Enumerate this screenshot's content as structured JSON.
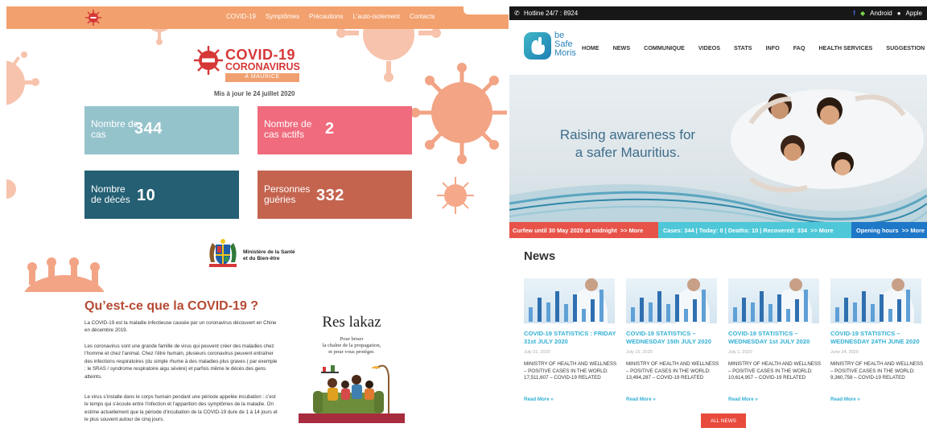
{
  "left": {
    "nav": {
      "links": [
        "COVID-19",
        "Symptômes",
        "Précautions",
        "L'auto-isolement",
        "Contacts"
      ]
    },
    "brand": {
      "title": "COVID-19",
      "subtitle": "CORONAVIRUS",
      "country": "À MAURICE"
    },
    "updated": "Mis à jour le 24 juillet 2020",
    "stats": [
      {
        "label": "Nombre de cas",
        "value": "344",
        "color": "#95c3cc"
      },
      {
        "label": "Nombre de cas actifs",
        "value": "2",
        "color": "#ef6b7d"
      },
      {
        "label": "Nombre de décès",
        "value": "10",
        "color": "#245f73"
      },
      {
        "label": "Personnes guéries",
        "value": "332",
        "color": "#c4644f"
      }
    ],
    "ministry": {
      "line1": "Ministère de la Santé",
      "line2": "et du Bien-être"
    },
    "section_title": "Qu’est-ce que la COVID-19 ?",
    "paragraphs": [
      "La COVID-19 est la maladie infectieuse causée par un coronavirus découvert en Chine en décembre 2019.",
      "Les coronavirus sont une grande famille de virus qui peuvent créer des maladies chez l’homme et chez l’animal. Chez l’être humain, plusieurs coronavirus peuvent entraîner des infections respiratoires (du simple rhume à des maladies plus graves ( par exemple : le SRAS / syndrome respiratoire aigu sévère) et parfois même le décès des gens atteints.",
      "Le virus s’installe dans le corps humain pendant une période appelée incubation : c’est le temps qui s’écoule entre l’infection et l’apparition des symptômes de la maladie. On estime actuellement que la période d’incubation de la COVID-19 dure de 1 à 14 jours et le plus souvent autour de cinq jours."
    ],
    "poster": {
      "title": "Res lakaz",
      "line1": "Pour briser",
      "line2": "la chaîne de la propagation,",
      "line3": "et pour vous protéger."
    },
    "accent": "#f2a06d"
  },
  "right": {
    "topbar": {
      "hotline": "Hotline 24/7 : 8924",
      "android": "Android",
      "apple": "Apple"
    },
    "brand": {
      "line1": "be",
      "line2": "Safe",
      "line3": "Moris"
    },
    "menu": [
      "HOME",
      "NEWS",
      "COMMUNIQUE",
      "VIDEOS",
      "STATS",
      "INFO",
      "FAQ",
      "HEALTH SERVICES",
      "SUGGESTION"
    ],
    "hero": {
      "line1": "Raising awareness for",
      "line2": "a safer Mauritius."
    },
    "ticker": [
      {
        "text": "Curfew until 30 May 2020 at midnight",
        "more": ">> More",
        "color": "#e85349"
      },
      {
        "text": "Cases: 344 | Today: 0 | Deaths: 10 | Recovered: 334",
        "more": ">> More",
        "color": "#4ec8d8"
      },
      {
        "text": "Opening hours",
        "more": ">> More",
        "color": "#1f77c8"
      }
    ],
    "news_title": "News",
    "news": [
      {
        "title": "COVID-19 STATISTICS : FRIDAY 31st JULY 2020",
        "date": "July 31, 2020",
        "excerpt": "MINISTRY OF HEALTH AND WELLNESS – POSITIVE CASES IN THE WORLD: 17,511,607 – COVID-19 RELATED",
        "more": "Read More »"
      },
      {
        "title": "COVID-19 STATISTICS – WEDNESDAY 15th JULY 2020",
        "date": "July 15, 2020",
        "excerpt": "MINISTRY OF HEALTH AND WELLNESS – POSITIVE CASES IN THE WORLD: 13,494,287 – COVID-19 RELATED",
        "more": "Read More »"
      },
      {
        "title": "COVID-19 STATISTICS – WEDNESDAY 1st JULY 2020",
        "date": "July 1, 2020",
        "excerpt": "MINISTRY OF HEALTH AND WELLNESS – POSITIVE CASES IN THE WORLD: 10,614,957 – COVID-19 RELATED",
        "more": "Read More »"
      },
      {
        "title": "COVID-19 STATISTICS – WEDNESDAY 24TH JUNE 2020",
        "date": "June 24, 2020",
        "excerpt": "MINISTRY OF HEALTH AND WELLNESS – POSITIVE CASES IN THE WORLD: 9,360,758 – COVID-19 RELATED",
        "more": "Read More »"
      }
    ],
    "all_news": "ALL NEWS",
    "accent": "#32b0d3"
  }
}
